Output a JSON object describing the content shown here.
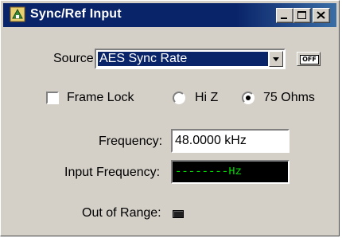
{
  "window": {
    "title": "Sync/Ref Input"
  },
  "source": {
    "label": "Source:",
    "selected": "AES Sync Rate",
    "off_label": "OFF"
  },
  "frame_lock": {
    "label": "Frame Lock",
    "checked": false
  },
  "impedance": {
    "options": [
      {
        "label": "Hi Z",
        "selected": false
      },
      {
        "label": "75 Ohms",
        "selected": true
      }
    ]
  },
  "frequency": {
    "label": "Frequency:",
    "value": "48.0000 kHz"
  },
  "input_frequency": {
    "label": "Input Frequency:",
    "value": "--------Hz"
  },
  "out_of_range": {
    "label": "Out of Range:"
  },
  "colors": {
    "title_bar": "#0a246a",
    "face": "#d4d0c8",
    "readout_text": "#00e000"
  }
}
